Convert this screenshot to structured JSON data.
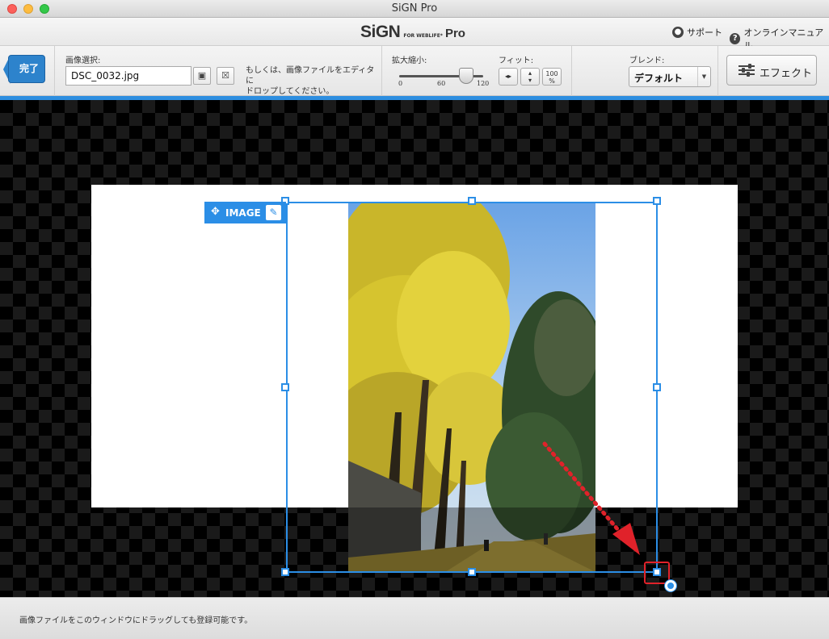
{
  "window": {
    "title": "SiGN Pro"
  },
  "header": {
    "logo_main": "SiGN",
    "logo_sub": "FOR WEBLIFE*",
    "logo_pro": "Pro",
    "support_label": "サポート",
    "manual_label": "オンラインマニュアル"
  },
  "toolbar": {
    "done_label": "完了",
    "image_select_label": "画像選択:",
    "file_name": "DSC_0032.jpg",
    "drop_hint_line1": "もしくは、画像ファイルをエディタに",
    "drop_hint_line2": "ドロップしてください。",
    "zoom_label": "拡大縮小:",
    "zoom_ticks": [
      "0",
      "60",
      "120"
    ],
    "zoom_value": 100,
    "zoom_max": 120,
    "fit_label": "フィット:",
    "fit_100_line1": "100",
    "fit_100_line2": "%",
    "blend_label": "ブレンド:",
    "blend_value": "デフォルト",
    "effect_label": "エフェクト"
  },
  "canvas": {
    "image_tag_label": "IMAGE",
    "selection_color": "#2b8ee6",
    "highlight_color": "#e0222a"
  },
  "status": {
    "text": "画像ファイルをこのウィンドウにドラッグしても登録可能です。"
  },
  "icons": [
    "person-icon",
    "help-icon",
    "image-icon",
    "clear-icon",
    "fit-width-icon",
    "fit-height-icon",
    "chevron-down-icon",
    "sliders-icon",
    "move-icon",
    "pencil-icon"
  ]
}
